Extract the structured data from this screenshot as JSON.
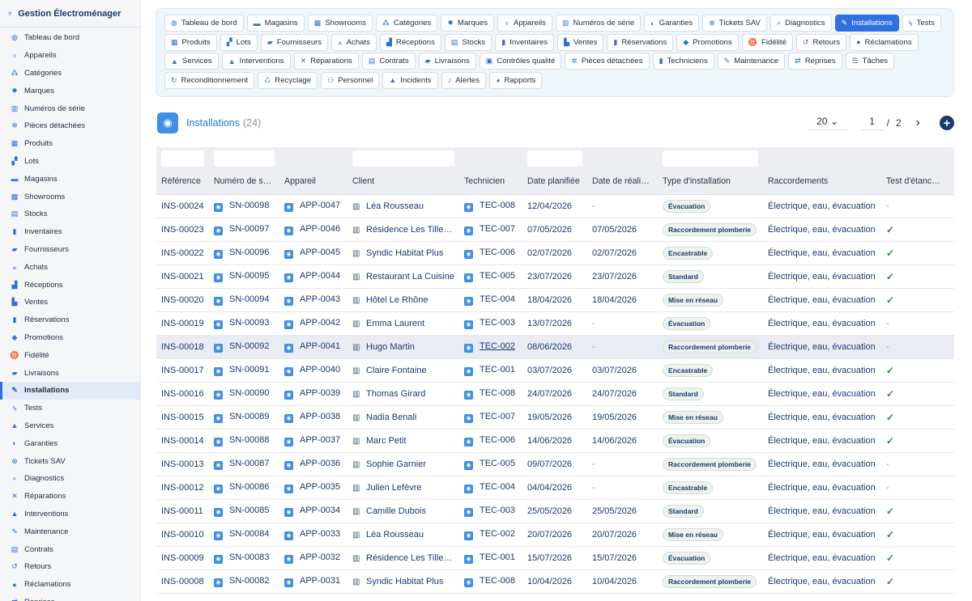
{
  "app": {
    "title": "Gestion Électroménager",
    "logo_icon": "plug-icon"
  },
  "sidebar": {
    "items": [
      {
        "label": "Tableau de bord",
        "icon": "◍",
        "active": false
      },
      {
        "label": "Appareils",
        "icon": "♆",
        "active": false
      },
      {
        "label": "Catégories",
        "icon": "⁂",
        "active": false
      },
      {
        "label": "Marques",
        "icon": "✹",
        "active": false
      },
      {
        "label": "Numéros de série",
        "icon": "▥",
        "active": false
      },
      {
        "label": "Pièces détachées",
        "icon": "✲",
        "active": false
      },
      {
        "label": "Produits",
        "icon": "▦",
        "active": false
      },
      {
        "label": "Lots",
        "icon": "▞",
        "active": false
      },
      {
        "label": "Magasins",
        "icon": "▬",
        "active": false
      },
      {
        "label": "Showrooms",
        "icon": "▩",
        "active": false
      },
      {
        "label": "Stocks",
        "icon": "▤",
        "active": false
      },
      {
        "label": "Inventaires",
        "icon": "▮",
        "active": false
      },
      {
        "label": "Fournisseurs",
        "icon": "▰",
        "active": false
      },
      {
        "label": "Achats",
        "icon": "⟑",
        "active": false
      },
      {
        "label": "Réceptions",
        "icon": "▟",
        "active": false
      },
      {
        "label": "Ventes",
        "icon": "▙",
        "active": false
      },
      {
        "label": "Réservations",
        "icon": "▮",
        "active": false
      },
      {
        "label": "Promotions",
        "icon": "◆",
        "active": false
      },
      {
        "label": "Fidélité",
        "icon": "♉",
        "active": false
      },
      {
        "label": "Livraisons",
        "icon": "▰",
        "active": false
      },
      {
        "label": "Installations",
        "icon": "✎",
        "active": true
      },
      {
        "label": "Tests",
        "icon": "ϟ",
        "active": false
      },
      {
        "label": "Services",
        "icon": "▲",
        "active": false
      },
      {
        "label": "Garanties",
        "icon": "◐",
        "active": false
      },
      {
        "label": "Tickets SAV",
        "icon": "⊗",
        "active": false
      },
      {
        "label": "Diagnostics",
        "icon": "⌕",
        "active": false
      },
      {
        "label": "Réparations",
        "icon": "✕",
        "active": false
      },
      {
        "label": "Interventions",
        "icon": "▲",
        "active": false
      },
      {
        "label": "Maintenance",
        "icon": "✎",
        "active": false
      },
      {
        "label": "Contrats",
        "icon": "▤",
        "active": false
      },
      {
        "label": "Retours",
        "icon": "↺",
        "active": false
      },
      {
        "label": "Réclamations",
        "icon": "●",
        "active": false
      },
      {
        "label": "Reprises",
        "icon": "⇄",
        "active": false
      }
    ]
  },
  "tabs": {
    "rows": [
      [
        {
          "label": "Tableau de bord",
          "icon": "◍"
        },
        {
          "label": "Magasins",
          "icon": "▬"
        },
        {
          "label": "Showrooms",
          "icon": "▩"
        },
        {
          "label": "Catégories",
          "icon": "⁂"
        },
        {
          "label": "Marques",
          "icon": "✹"
        },
        {
          "label": "Appareils",
          "icon": "♆"
        },
        {
          "label": "Numéros de série",
          "icon": "▥"
        },
        {
          "label": "Garanties",
          "icon": "◐"
        },
        {
          "label": "Tickets SAV",
          "icon": "⊗"
        },
        {
          "label": "Diagnostics",
          "icon": "⌕"
        },
        {
          "label": "Installations",
          "icon": "✎",
          "active": true
        },
        {
          "label": "Tests",
          "icon": "ϟ"
        }
      ],
      [
        {
          "label": "Produits",
          "icon": "▦"
        },
        {
          "label": "Lots",
          "icon": "▞"
        },
        {
          "label": "Fournisseurs",
          "icon": "▰"
        },
        {
          "label": "Achats",
          "icon": "⟑"
        },
        {
          "label": "Réceptions",
          "icon": "▟"
        },
        {
          "label": "Stocks",
          "icon": "▤"
        },
        {
          "label": "Inventaires",
          "icon": "▮"
        },
        {
          "label": "Ventes",
          "icon": "▙"
        },
        {
          "label": "Réservations",
          "icon": "▮"
        },
        {
          "label": "Promotions",
          "icon": "◆"
        },
        {
          "label": "Fidélité",
          "icon": "♉"
        },
        {
          "label": "Retours",
          "icon": "↺"
        },
        {
          "label": "Réclamations",
          "icon": "●"
        }
      ],
      [
        {
          "label": "Services",
          "icon": "▲"
        },
        {
          "label": "Interventions",
          "icon": "▲"
        },
        {
          "label": "Réparations",
          "icon": "✕"
        },
        {
          "label": "Contrats",
          "icon": "▤"
        },
        {
          "label": "Livraisons",
          "icon": "▰"
        },
        {
          "label": "Contrôles qualité",
          "icon": "▣"
        },
        {
          "label": "Pièces détachées",
          "icon": "✲"
        },
        {
          "label": "Techniciens",
          "icon": "▮"
        },
        {
          "label": "Maintenance",
          "icon": "✎"
        },
        {
          "label": "Reprises",
          "icon": "⇄"
        },
        {
          "label": "Tâches",
          "icon": "☰"
        }
      ],
      [
        {
          "label": "Reconditionnement",
          "icon": "↻"
        },
        {
          "label": "Recyclage",
          "icon": "♺"
        },
        {
          "label": "Personnel",
          "icon": "⚇"
        },
        {
          "label": "Incidents",
          "icon": "▲"
        },
        {
          "label": "Alertes",
          "icon": "♪"
        },
        {
          "label": "Rapports",
          "icon": "◕"
        }
      ]
    ]
  },
  "header": {
    "title": "Installations",
    "count": "(24)",
    "page_size": "20",
    "page": "1",
    "separator": "/",
    "total_pages": "2",
    "next": "›",
    "add": "+"
  },
  "table": {
    "columns": [
      {
        "label": "Référence",
        "filter": true
      },
      {
        "label": "Numéro de s…",
        "filter": true
      },
      {
        "label": "Appareil",
        "filter": false
      },
      {
        "label": "Client",
        "filter": true
      },
      {
        "label": "Technicien",
        "filter": false
      },
      {
        "label": "Date planifiée",
        "filter": true
      },
      {
        "label": "Date de réali…",
        "filter": false
      },
      {
        "label": "Type d'installation",
        "filter": true
      },
      {
        "label": "Raccordements",
        "filter": false
      },
      {
        "label": "Test d'étanc…",
        "filter": false
      }
    ],
    "rows": [
      {
        "ref": "INS-00024",
        "serial": "SN-00098",
        "app": "APP-0047",
        "client": "Léa Rousseau",
        "tech": "TEC-008",
        "planned": "12/04/2026",
        "done": "-",
        "type": "Évacuation",
        "conn": "Électrique, eau, évacuation",
        "test": "-"
      },
      {
        "ref": "INS-00023",
        "serial": "SN-00097",
        "app": "APP-0046",
        "client": "Résidence Les Tilleuls",
        "tech": "TEC-007",
        "planned": "07/05/2026",
        "done": "07/05/2026",
        "type": "Raccordement plomberie",
        "conn": "Électrique, eau, évacuation",
        "test": "✓"
      },
      {
        "ref": "INS-00022",
        "serial": "SN-00096",
        "app": "APP-0045",
        "client": "Syndic Habitat Plus",
        "tech": "TEC-006",
        "planned": "02/07/2026",
        "done": "02/07/2026",
        "type": "Encastrable",
        "conn": "Électrique, eau, évacuation",
        "test": "✓"
      },
      {
        "ref": "INS-00021",
        "serial": "SN-00095",
        "app": "APP-0044",
        "client": "Restaurant La Cuisine",
        "tech": "TEC-005",
        "planned": "23/07/2026",
        "done": "23/07/2026",
        "type": "Standard",
        "conn": "Électrique, eau, évacuation",
        "test": "✓"
      },
      {
        "ref": "INS-00020",
        "serial": "SN-00094",
        "app": "APP-0043",
        "client": "Hôtel Le Rhône",
        "tech": "TEC-004",
        "planned": "18/04/2026",
        "done": "18/04/2026",
        "type": "Mise en réseau",
        "conn": "Électrique, eau, évacuation",
        "test": "✓"
      },
      {
        "ref": "INS-00019",
        "serial": "SN-00093",
        "app": "APP-0042",
        "client": "Emma Laurent",
        "tech": "TEC-003",
        "planned": "13/07/2026",
        "done": "-",
        "type": "Évacuation",
        "conn": "Électrique, eau, évacuation",
        "test": "-"
      },
      {
        "ref": "INS-00018",
        "serial": "SN-00092",
        "app": "APP-0041",
        "client": "Hugo Martin",
        "tech": "TEC-002",
        "planned": "08/06/2026",
        "done": "-",
        "type": "Raccordement plomberie",
        "conn": "Électrique, eau, évacuation",
        "test": "-",
        "highlight": true
      },
      {
        "ref": "INS-00017",
        "serial": "SN-00091",
        "app": "APP-0040",
        "client": "Claire Fontaine",
        "tech": "TEC-001",
        "planned": "03/07/2026",
        "done": "03/07/2026",
        "type": "Encastrable",
        "conn": "Électrique, eau, évacuation",
        "test": "✓"
      },
      {
        "ref": "INS-00016",
        "serial": "SN-00090",
        "app": "APP-0039",
        "client": "Thomas Girard",
        "tech": "TEC-008",
        "planned": "24/07/2026",
        "done": "24/07/2026",
        "type": "Standard",
        "conn": "Électrique, eau, évacuation",
        "test": "✓"
      },
      {
        "ref": "INS-00015",
        "serial": "SN-00089",
        "app": "APP-0038",
        "client": "Nadia Benali",
        "tech": "TEC-007",
        "planned": "19/05/2026",
        "done": "19/05/2026",
        "type": "Mise en réseau",
        "conn": "Électrique, eau, évacuation",
        "test": "✓"
      },
      {
        "ref": "INS-00014",
        "serial": "SN-00088",
        "app": "APP-0037",
        "client": "Marc Petit",
        "tech": "TEC-006",
        "planned": "14/06/2026",
        "done": "14/06/2026",
        "type": "Évacuation",
        "conn": "Électrique, eau, évacuation",
        "test": "✓"
      },
      {
        "ref": "INS-00013",
        "serial": "SN-00087",
        "app": "APP-0036",
        "client": "Sophie Garnier",
        "tech": "TEC-005",
        "planned": "09/07/2026",
        "done": "-",
        "type": "Raccordement plomberie",
        "conn": "Électrique, eau, évacuation",
        "test": "-"
      },
      {
        "ref": "INS-00012",
        "serial": "SN-00086",
        "app": "APP-0035",
        "client": "Julien Lefèvre",
        "tech": "TEC-004",
        "planned": "04/04/2026",
        "done": "-",
        "type": "Encastrable",
        "conn": "Électrique, eau, évacuation",
        "test": "-"
      },
      {
        "ref": "INS-00011",
        "serial": "SN-00085",
        "app": "APP-0034",
        "client": "Camille Dubois",
        "tech": "TEC-003",
        "planned": "25/05/2026",
        "done": "25/05/2026",
        "type": "Standard",
        "conn": "Électrique, eau, évacuation",
        "test": "✓"
      },
      {
        "ref": "INS-00010",
        "serial": "SN-00084",
        "app": "APP-0033",
        "client": "Léa Rousseau",
        "tech": "TEC-002",
        "planned": "20/07/2026",
        "done": "20/07/2026",
        "type": "Mise en réseau",
        "conn": "Électrique, eau, évacuation",
        "test": "✓"
      },
      {
        "ref": "INS-00009",
        "serial": "SN-00083",
        "app": "APP-0032",
        "client": "Résidence Les Tilleuls",
        "tech": "TEC-001",
        "planned": "15/07/2026",
        "done": "15/07/2026",
        "type": "Évacuation",
        "conn": "Électrique, eau, évacuation",
        "test": "✓"
      },
      {
        "ref": "INS-00008",
        "serial": "SN-00082",
        "app": "APP-0031",
        "client": "Syndic Habitat Plus",
        "tech": "TEC-008",
        "planned": "10/04/2026",
        "done": "10/04/2026",
        "type": "Raccordement plomberie",
        "conn": "Électrique, eau, évacuation",
        "test": "✓"
      }
    ]
  }
}
